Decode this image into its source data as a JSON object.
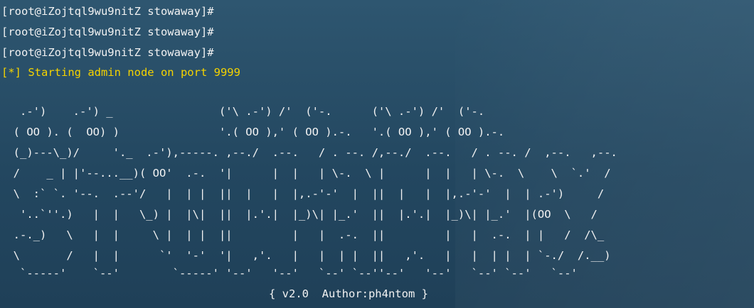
{
  "terminal": {
    "prompts": [
      "[root@iZojtql9wu9nitZ stowaway]#",
      "[root@iZojtql9wu9nitZ stowaway]#",
      "[root@iZojtql9wu9nitZ stowaway]#"
    ],
    "status_line": "[*] Starting admin node on port 9999",
    "banner_lines": [
      "   .-')    .-') _                ('\\ .-') /'  ('-.      ('\\ .-') /'  ('-.",
      "  ( OO ). (  OO) )               '.( OO ),' ( OO ).-.   '.( OO ),' ( OO ).-.",
      "  (_)---\\_)/     '._  .-'),-----. ,--./  .--.   / . --. /,--./  .--.   / . --. /  ,--.   ,--.",
      "  /    _ | |'--...__)( OO'  .-.  '|      |  |   | \\-.  \\ |      |  |   | \\-.  \\    \\  `.'  /",
      "  \\  :` `. '--.  .--'/   |  | |  ||  |   |  |,.-'-'  |  ||  |   |  |,.-'-'  |  | .-')     /",
      "   '..`''.)   |  |   \\_) |  |\\|  ||  |.'.|  |_)\\| |_.'  ||  |.'.|  |_)\\| |_.'  |(OO  \\   /",
      "  .-._)   \\   |  |     \\ |  | |  ||         |   |  .-.  ||         |   |  .-.  | |   /  /\\_",
      "  \\       /   |  |      `'  '-'  '|   ,'.   |   |  | |  ||   ,'.   |   |  | |  | `-./  /.__)",
      "   `-----'    `--'        `-----' '--'   '--'   `--' `--''--'   '--'   `--' `--'   `--'"
    ],
    "footer": "{ v2.0  Author:ph4ntom }"
  },
  "colors": {
    "background_top": "#2e5670",
    "background_bottom": "#1f4058",
    "text": "#f2f2f2",
    "status": "#f5d300"
  }
}
